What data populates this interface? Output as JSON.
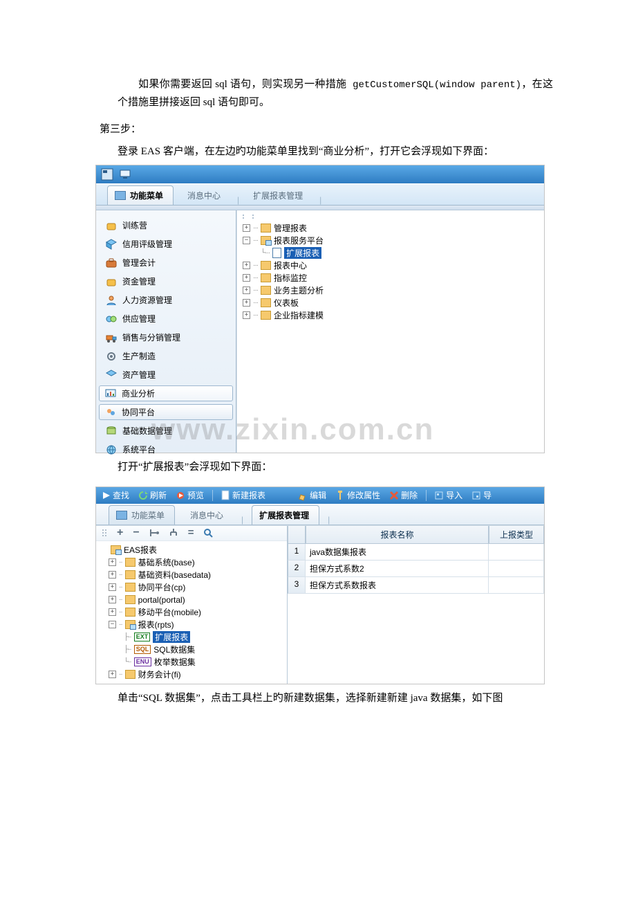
{
  "para1_a": "如果你需要返回 sql 语句，则实现另一种措施",
  "para1_code": " getCustomerSQL(window parent)",
  "para1_b": "，在这个措施里拼接返回 sql 语句即可。",
  "step3": "第三步：",
  "step3_desc": "登录 EAS 客户端，在左边旳功能菜单里找到“商业分析”，打开它会浮现如下界面：",
  "shot1": {
    "tabs": {
      "functions": "功能菜单",
      "msgcenter": "消息中心",
      "ext": "扩展报表管理"
    },
    "nav": [
      "训练营",
      "信用评级管理",
      "管理会计",
      "资金管理",
      "人力资源管理",
      "供应管理",
      "销售与分销管理",
      "生产制造",
      "资产管理",
      "商业分析",
      "协同平台",
      "基础数据管理",
      "系统平台"
    ],
    "tree": {
      "n0": "管理报表",
      "n1": "报表服务平台",
      "n1a": "扩展报表",
      "n2": "报表中心",
      "n3": "指标监控",
      "n4": "业务主题分析",
      "n5": "仪表板",
      "n6": "企业指标建模"
    }
  },
  "watermark": "www.zixin.com.cn",
  "mid_text": "打开“扩展报表”会浮现如下界面：",
  "shot2": {
    "toolbar": {
      "find": "查找",
      "refresh": "刷新",
      "preview": "预览",
      "newreport": "新建报表",
      "edit": "编辑",
      "editprop": "修改属性",
      "delete": "删除",
      "import": "导入",
      "export": "导"
    },
    "tabs": {
      "functions": "功能菜单",
      "msgcenter": "消息中心",
      "ext": "扩展报表管理"
    },
    "ltree": {
      "root": "EAS报表",
      "base": "基础系统(base)",
      "basedata": "基础资料(basedata)",
      "cp": "协同平台(cp)",
      "portal": "portal(portal)",
      "mobile": "移动平台(mobile)",
      "rpts": "报表(rpts)",
      "ext": "扩展报表",
      "sql": " SQL数据集",
      "enum": " 枚举数据集",
      "fi": "财务会计(fi)"
    },
    "table": {
      "col_name": "报表名称",
      "col_type": "上报类型",
      "rows": [
        {
          "n": "1",
          "name": "java数据集报表"
        },
        {
          "n": "2",
          "name": "担保方式系数2"
        },
        {
          "n": "3",
          "name": "担保方式系数报表"
        }
      ]
    }
  },
  "footer_text": "单击“SQL 数据集”，点击工具栏上旳新建数据集，选择新建新建 java 数据集，如下图"
}
